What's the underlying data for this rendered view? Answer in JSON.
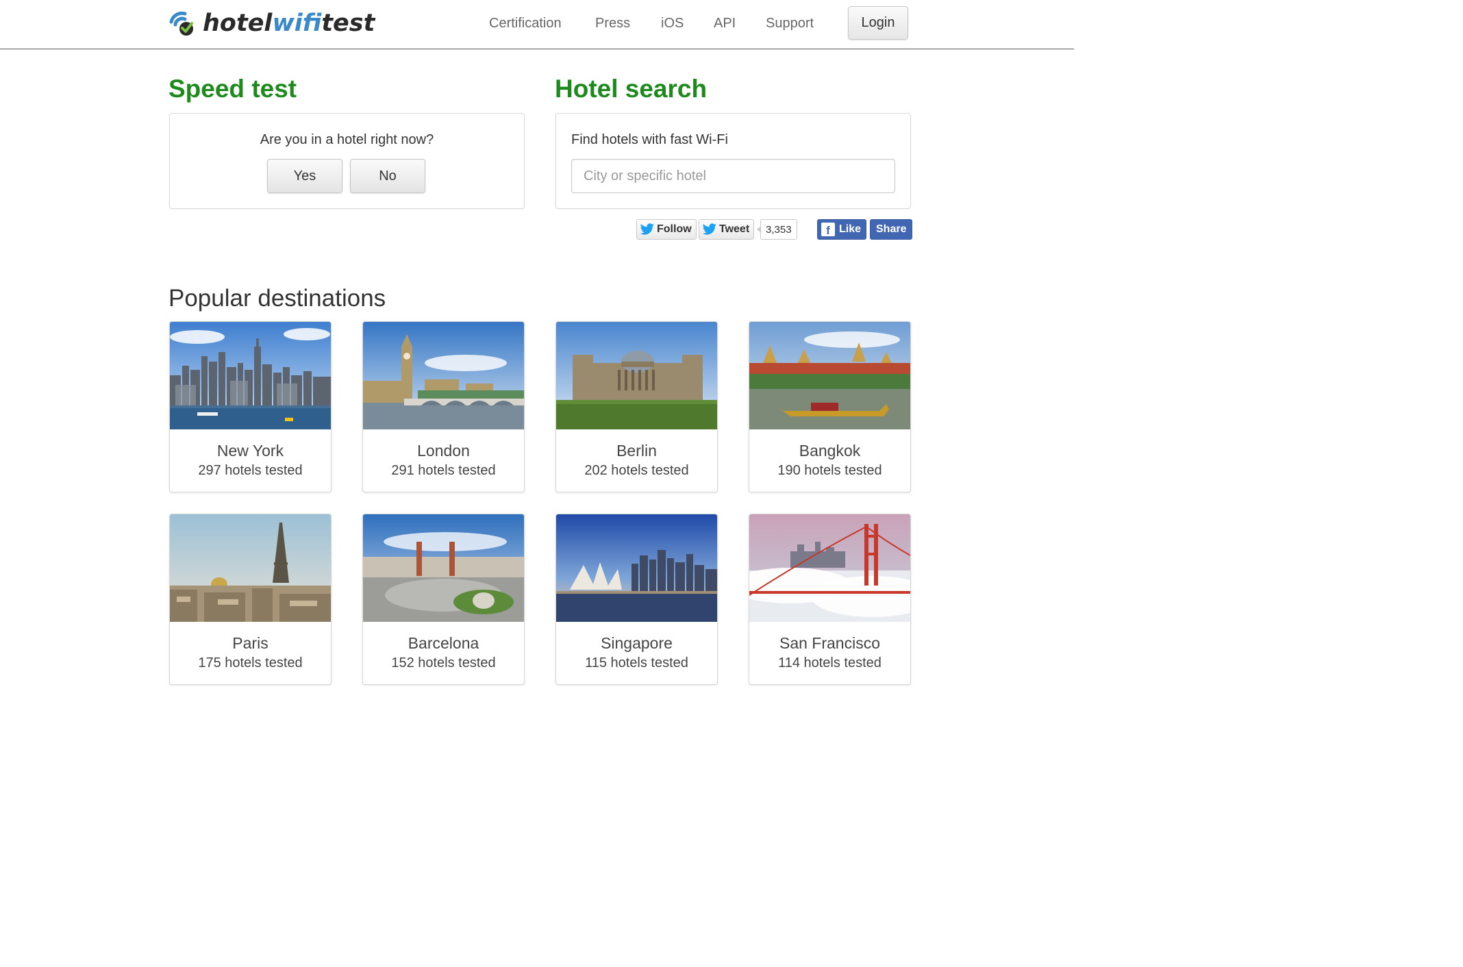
{
  "header": {
    "logo_prefix": "hotel",
    "logo_wifi": "wifi",
    "logo_suffix": "test",
    "nav": [
      "Certification",
      "Press",
      "iOS",
      "API",
      "Support"
    ],
    "login_label": "Login"
  },
  "speed_test": {
    "title": "Speed test",
    "question": "Are you in a hotel right now?",
    "yes_label": "Yes",
    "no_label": "No"
  },
  "hotel_search": {
    "title": "Hotel search",
    "prompt": "Find hotels with fast Wi-Fi",
    "placeholder": "City or specific hotel"
  },
  "social": {
    "follow_label": "Follow",
    "tweet_label": "Tweet",
    "tweet_count": "3,353",
    "like_label": "Like",
    "share_label": "Share"
  },
  "popular": {
    "title": "Popular destinations",
    "destinations": [
      {
        "name": "New York",
        "count": "297 hotels tested",
        "scene": "skyline-water"
      },
      {
        "name": "London",
        "count": "291 hotels tested",
        "scene": "bridge-tower"
      },
      {
        "name": "Berlin",
        "count": "202 hotels tested",
        "scene": "domed-building"
      },
      {
        "name": "Bangkok",
        "count": "190 hotels tested",
        "scene": "temple-river"
      },
      {
        "name": "Paris",
        "count": "175 hotels tested",
        "scene": "eiffel-tower"
      },
      {
        "name": "Barcelona",
        "count": "152 hotels tested",
        "scene": "plaza-fountain"
      },
      {
        "name": "Singapore",
        "count": "115 hotels tested",
        "scene": "skyline-dusk"
      },
      {
        "name": "San Francisco",
        "count": "114 hotels tested",
        "scene": "bridge-fog"
      }
    ]
  },
  "colors": {
    "green_heading": "#1e8a1e",
    "logo_blue": "#3a89c9",
    "facebook_blue": "#4267b2",
    "twitter_blue": "#1da1f2"
  }
}
